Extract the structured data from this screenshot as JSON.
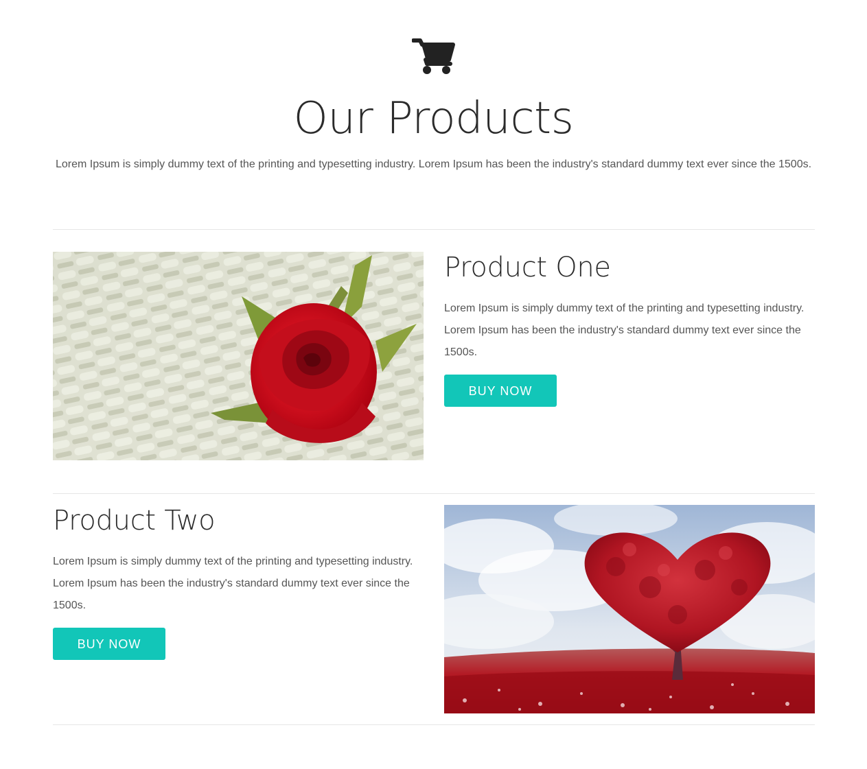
{
  "header": {
    "icon": "shopping-cart-icon",
    "title": "Our Products",
    "intro": "Lorem Ipsum is simply dummy text of the printing and typesetting industry. Lorem Ipsum has been the industry's standard dummy text ever since the 1500s."
  },
  "products": [
    {
      "title": "Product One",
      "description": "Lorem Ipsum is simply dummy text of the printing and typesetting industry. Lorem Ipsum has been the industry's standard dummy text ever since the 1500s.",
      "button_label": "BUY NOW",
      "image": "red-rose-on-wicker-image"
    },
    {
      "title": "Product Two",
      "description": "Lorem Ipsum is simply dummy text of the printing and typesetting industry. Lorem Ipsum has been the industry's standard dummy text ever since the 1500s.",
      "button_label": "BUY NOW",
      "image": "heart-shaped-red-tree-image"
    }
  ],
  "colors": {
    "accent": "#12c6b8",
    "heading": "#2b2b2b",
    "body_text": "#555555",
    "divider": "#e6e6e6"
  }
}
